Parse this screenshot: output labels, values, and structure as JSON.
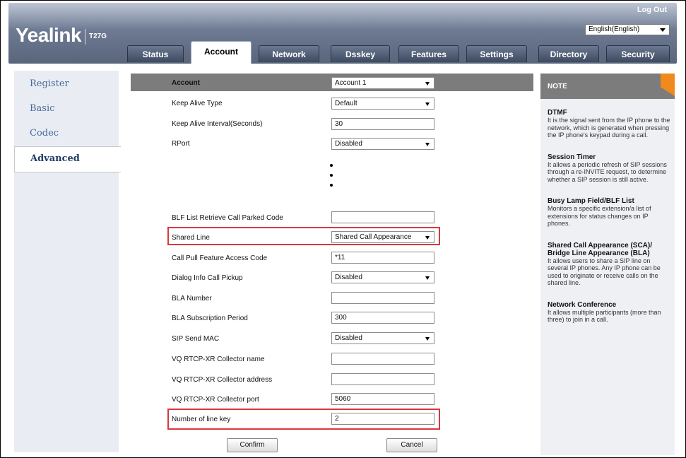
{
  "header": {
    "brand": "Yealink",
    "model": "T27G",
    "logout": "Log Out",
    "language": "English(English)"
  },
  "tabs": [
    {
      "label": "Status",
      "active": false
    },
    {
      "label": "Account",
      "active": true
    },
    {
      "label": "Network",
      "active": false
    },
    {
      "label": "Dsskey",
      "active": false
    },
    {
      "label": "Features",
      "active": false
    },
    {
      "label": "Settings",
      "active": false
    },
    {
      "label": "Directory",
      "active": false
    },
    {
      "label": "Security",
      "active": false
    }
  ],
  "sidebar": {
    "items": [
      {
        "label": "Register",
        "active": false
      },
      {
        "label": "Basic",
        "active": false
      },
      {
        "label": "Codec",
        "active": false
      },
      {
        "label": "Advanced",
        "active": true
      }
    ]
  },
  "form": {
    "account_label": "Account",
    "account_value": "Account 1",
    "rows_top": [
      {
        "label": "Keep Alive Type",
        "value": "Default",
        "type": "select"
      },
      {
        "label": "Keep Alive Interval(Seconds)",
        "value": "30",
        "type": "text"
      },
      {
        "label": "RPort",
        "value": "Disabled",
        "type": "select"
      }
    ],
    "rows_bottom": [
      {
        "label": "BLF List Retrieve Call Parked Code",
        "value": "",
        "type": "text"
      },
      {
        "label": "Shared Line",
        "value": "Shared Call Appearance",
        "type": "select",
        "highlight": true
      },
      {
        "label": "Call Pull Feature Access Code",
        "value": "*11",
        "type": "text"
      },
      {
        "label": "Dialog Info Call Pickup",
        "value": "Disabled",
        "type": "select"
      },
      {
        "label": "BLA Number",
        "value": "",
        "type": "text"
      },
      {
        "label": "BLA Subscription Period",
        "value": "300",
        "type": "text"
      },
      {
        "label": "SIP Send MAC",
        "value": "Disabled",
        "type": "select"
      },
      {
        "label": "VQ RTCP-XR Collector name",
        "value": "",
        "type": "text"
      },
      {
        "label": "VQ RTCP-XR Collector address",
        "value": "",
        "type": "text"
      },
      {
        "label": "VQ RTCP-XR Collector port",
        "value": "5060",
        "type": "text"
      },
      {
        "label": "Number of line key",
        "value": "2",
        "type": "text",
        "highlight": true
      }
    ],
    "confirm_label": "Confirm",
    "cancel_label": "Cancel"
  },
  "note": {
    "header": "NOTE",
    "sections": [
      {
        "title": "DTMF",
        "text": "It is the signal sent from the IP phone to the network, which is generated when pressing the IP phone's keypad during a call."
      },
      {
        "title": "Session Timer",
        "text": "It allows a periodic refresh of SIP sessions through a re-INVITE request, to determine whether a SIP session is still active."
      },
      {
        "title": "Busy Lamp Field/BLF List",
        "text": "Monitors a specific extension/a list of extensions for status changes on IP phones."
      },
      {
        "title": "Shared Call Appearance (SCA)/ Bridge Line Appearance (BLA)",
        "text": "It allows users to share a SIP line on several IP phones. Any IP phone can be used to originate or receive calls on the shared line."
      },
      {
        "title": "Network Conference",
        "text": "It allows multiple participants (more than three) to join in a call."
      }
    ]
  },
  "colors": {
    "highlight": "#d9373f",
    "note_accent": "#f08a1c",
    "nav_link": "#4a6aa0"
  }
}
